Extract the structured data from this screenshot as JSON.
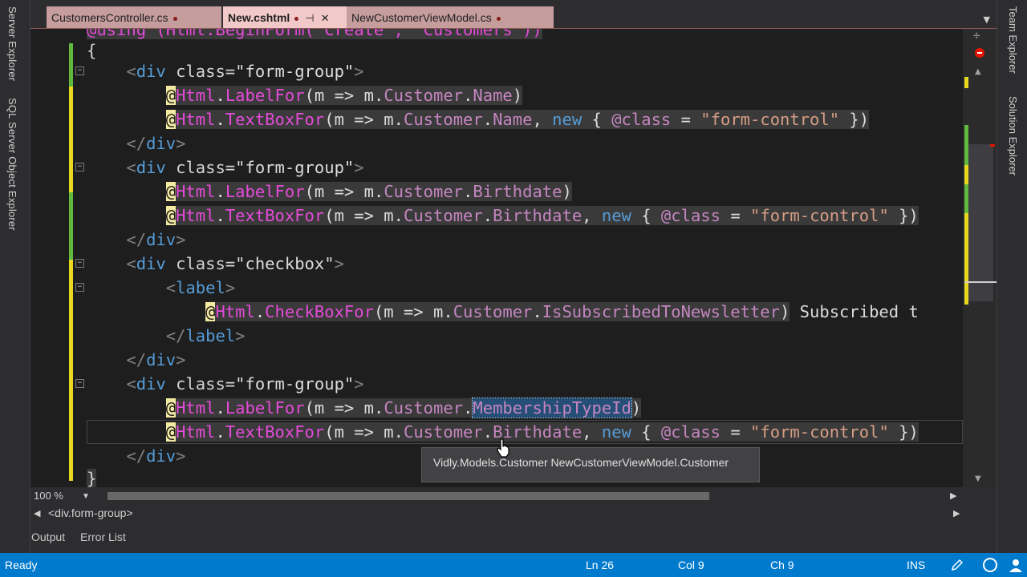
{
  "left_toolwindows": [
    "Server Explorer",
    "SQL Server Object Explorer"
  ],
  "right_toolwindows": [
    "Team Explorer",
    "Solution Explorer"
  ],
  "tabs": [
    {
      "label": "CustomersController.cs",
      "state": "inactive",
      "modified": true
    },
    {
      "label": "New.cshtml",
      "state": "active",
      "modified": true,
      "pinned": true
    },
    {
      "label": "NewCustomerViewModel.cs",
      "state": "inactive",
      "modified": true
    }
  ],
  "code": {
    "l0": {
      "ind": "",
      "rest": "@using (Html.BeginForm(\"Create\", \"Customers\"))"
    },
    "l1": {
      "ind": "",
      "rest": "{"
    },
    "l2": {
      "ind": "    ",
      "open": "<",
      "tag": "div",
      "attr": " class=",
      "val": "\"form-group\"",
      "close": ">"
    },
    "l3": {
      "ind": "        ",
      "at": "@",
      "obj": "Html",
      "dot": ".",
      "method": "LabelFor",
      "args": "(m => m.",
      "prop1": "Customer",
      "dot2": ".",
      "prop2": "Name",
      "tail": ")"
    },
    "l4": {
      "ind": "        ",
      "at": "@",
      "obj": "Html",
      "dot": ".",
      "method": "TextBoxFor",
      "args": "(m => m.",
      "prop1": "Customer",
      "dot2": ".",
      "prop2": "Name",
      "comma": ", ",
      "kw": "new",
      "brace": " { ",
      "cls": "@class",
      "eq": " = ",
      "str": "\"form-control\"",
      "end": " })"
    },
    "l5": {
      "ind": "    ",
      "open": "</",
      "tag": "div",
      "close": ">"
    },
    "l6": {
      "ind": "    ",
      "open": "<",
      "tag": "div",
      "attr": " class=",
      "val": "\"form-group\"",
      "close": ">"
    },
    "l7": {
      "ind": "        ",
      "at": "@",
      "obj": "Html",
      "dot": ".",
      "method": "LabelFor",
      "args": "(m => m.",
      "prop1": "Customer",
      "dot2": ".",
      "prop2": "Birthdate",
      "tail": ")"
    },
    "l8": {
      "ind": "        ",
      "at": "@",
      "obj": "Html",
      "dot": ".",
      "method": "TextBoxFor",
      "args": "(m => m.",
      "prop1": "Customer",
      "dot2": ".",
      "prop2": "Birthdate",
      "comma": ", ",
      "kw": "new",
      "brace": " { ",
      "cls": "@class",
      "eq": " = ",
      "str": "\"form-control\"",
      "end": " })"
    },
    "l9": {
      "ind": "    ",
      "open": "</",
      "tag": "div",
      "close": ">"
    },
    "l10": {
      "ind": "    ",
      "open": "<",
      "tag": "div",
      "attr": " class=",
      "val": "\"checkbox\"",
      "close": ">"
    },
    "l11": {
      "ind": "        ",
      "open": "<",
      "tag": "label",
      "close": ">"
    },
    "l12": {
      "ind": "            ",
      "at": "@",
      "obj": "Html",
      "dot": ".",
      "method": "CheckBoxFor",
      "args": "(m => m.",
      "prop1": "Customer",
      "dot2": ".",
      "prop2": "IsSubscribedToNewsletter",
      "tail": ")",
      "text": " Subscribed t"
    },
    "l13": {
      "ind": "        ",
      "open": "</",
      "tag": "label",
      "close": ">"
    },
    "l14": {
      "ind": "    ",
      "open": "</",
      "tag": "div",
      "close": ">"
    },
    "l15": {
      "ind": "    ",
      "open": "<",
      "tag": "div",
      "attr": " class=",
      "val": "\"form-group\"",
      "close": ">"
    },
    "l16": {
      "ind": "        ",
      "at": "@",
      "obj": "Html",
      "dot": ".",
      "method": "LabelFor",
      "args": "(m => m.",
      "prop1": "Customer",
      "dot2": ".",
      "prop2": "MembershipTypeId",
      "tail": ")"
    },
    "l17": {
      "ind": "        ",
      "at": "@",
      "obj": "Html",
      "dot": ".",
      "method": "TextBoxFor",
      "args": "(m => m.",
      "prop1": "Customer",
      "dot2": ".",
      "prop2": "Birthdate",
      "comma": ", ",
      "kw": "new",
      "brace": " { ",
      "cls": "@class",
      "eq": " = ",
      "str": "\"form-control\"",
      "end": " })"
    },
    "l18": {
      "ind": "    ",
      "open": "</",
      "tag": "div",
      "close": ">"
    },
    "l19": {
      "ind": "",
      "rest": "}"
    }
  },
  "tooltip": "Vidly.Models.Customer NewCustomerViewModel.Customer",
  "zoom": "100 %",
  "breadcrumb": "<div.form-group>",
  "toolwindow_tabs": [
    "Output",
    "Error List"
  ],
  "status": {
    "ready": "Ready",
    "ln": "Ln 26",
    "col": "Col 9",
    "ch": "Ch 9",
    "mode": "INS"
  },
  "colors": {
    "status_bar": "#007acc",
    "active_tab": "#f2c9c9",
    "inactive_tab": "#c59d9d",
    "editor_bg": "#1e1e1e"
  }
}
